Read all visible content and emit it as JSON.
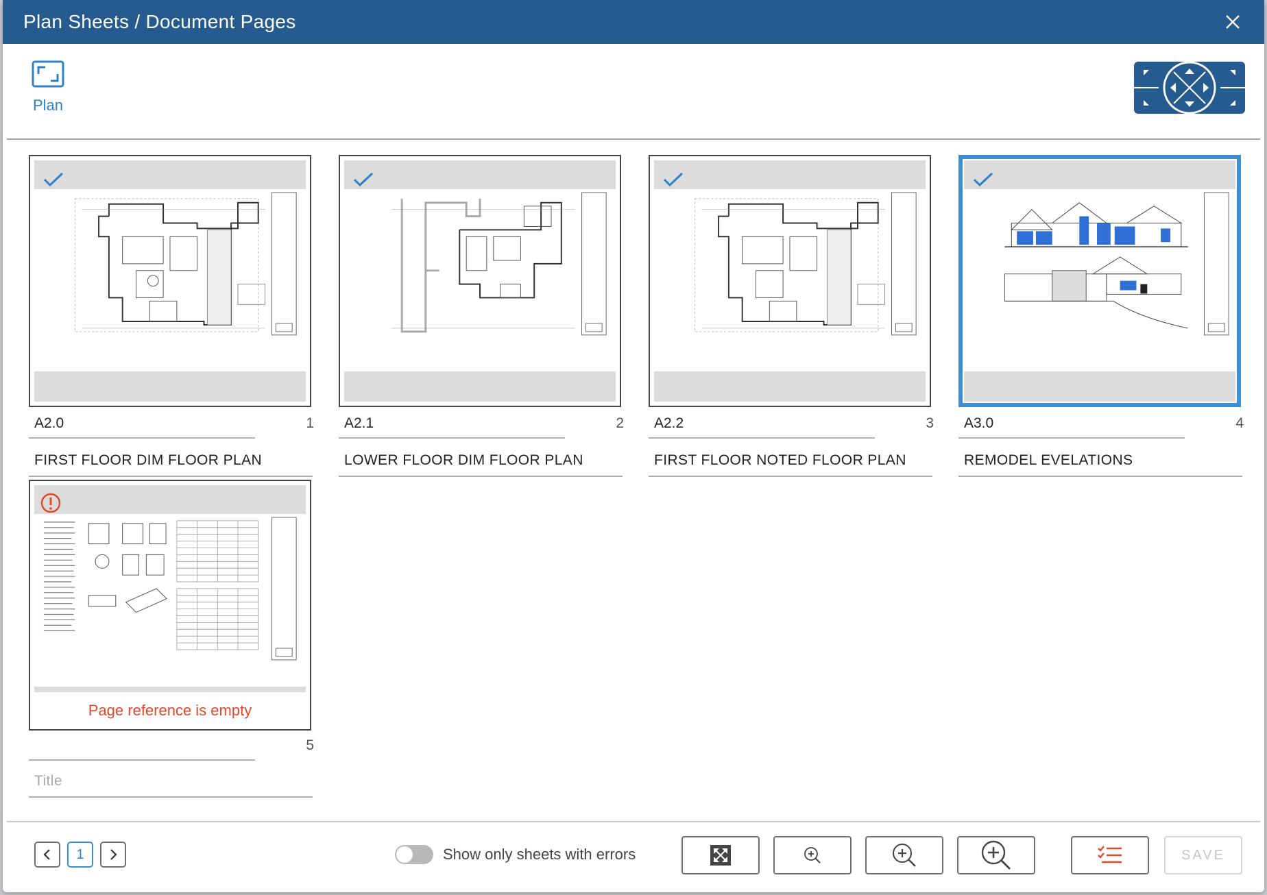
{
  "dialog": {
    "title": "Plan Sheets / Document Pages"
  },
  "toolbar": {
    "plan_label": "Plan"
  },
  "sheets": [
    {
      "reference": "A2.0",
      "number": "1",
      "title": "FIRST FLOOR DIM FLOOR PLAN",
      "status": "ok",
      "selected": false
    },
    {
      "reference": "A2.1",
      "number": "2",
      "title": "LOWER FLOOR DIM FLOOR PLAN",
      "status": "ok",
      "selected": false
    },
    {
      "reference": "A2.2",
      "number": "3",
      "title": "FIRST FLOOR NOTED FLOOR PLAN",
      "status": "ok",
      "selected": false
    },
    {
      "reference": "A3.0",
      "number": "4",
      "title": "REMODEL EVELATIONS",
      "status": "ok",
      "selected": true
    },
    {
      "reference": "",
      "number": "5",
      "title": "",
      "title_placeholder": "Title",
      "status": "error",
      "error_message": "Page reference is empty",
      "selected": false
    }
  ],
  "footer": {
    "current_page": "1",
    "toggle_label": "Show only sheets with errors",
    "toggle_on": false,
    "save_label": "SAVE"
  },
  "colors": {
    "header": "#265b8f",
    "accent": "#3d8fd1",
    "error": "#e04a2a",
    "check": "#2f80c4"
  },
  "icons": {
    "close": "close-icon",
    "plan": "fit-frame-icon",
    "nav": "pan-navigation-icon",
    "check": "check-icon",
    "error": "error-icon",
    "fit": "fit-page-icon",
    "zoom_small": "zoom-in-small-icon",
    "zoom_medium": "zoom-in-medium-icon",
    "zoom_large": "zoom-in-large-icon",
    "list": "checklist-icon"
  }
}
